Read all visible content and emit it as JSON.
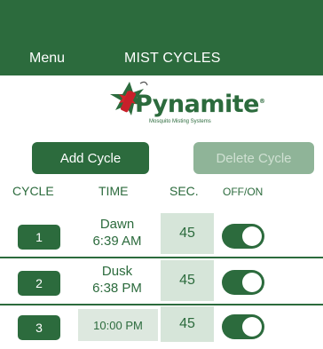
{
  "header": {
    "menu_label": "Menu",
    "title": "MIST CYCLES",
    "color": "#2c6b3d"
  },
  "logo": {
    "wordmark": "Pynamite",
    "trademark": "®",
    "tagline": "Mosquito Misting Systems"
  },
  "actions": {
    "add_label": "Add Cycle",
    "delete_label": "Delete Cycle"
  },
  "columns": {
    "cycle": "CYCLE",
    "time": "TIME",
    "sec": "SEC.",
    "onoff": "OFF/ON"
  },
  "cycles": [
    {
      "number": "1",
      "time_line1": "Dawn",
      "time_line2": "6:39 AM",
      "seconds": "45",
      "on": true
    },
    {
      "number": "2",
      "time_line1": "Dusk",
      "time_line2": "6:38 PM",
      "seconds": "45",
      "on": true
    },
    {
      "number": "3",
      "time": "10:00 PM",
      "seconds": "45",
      "on": true
    }
  ]
}
